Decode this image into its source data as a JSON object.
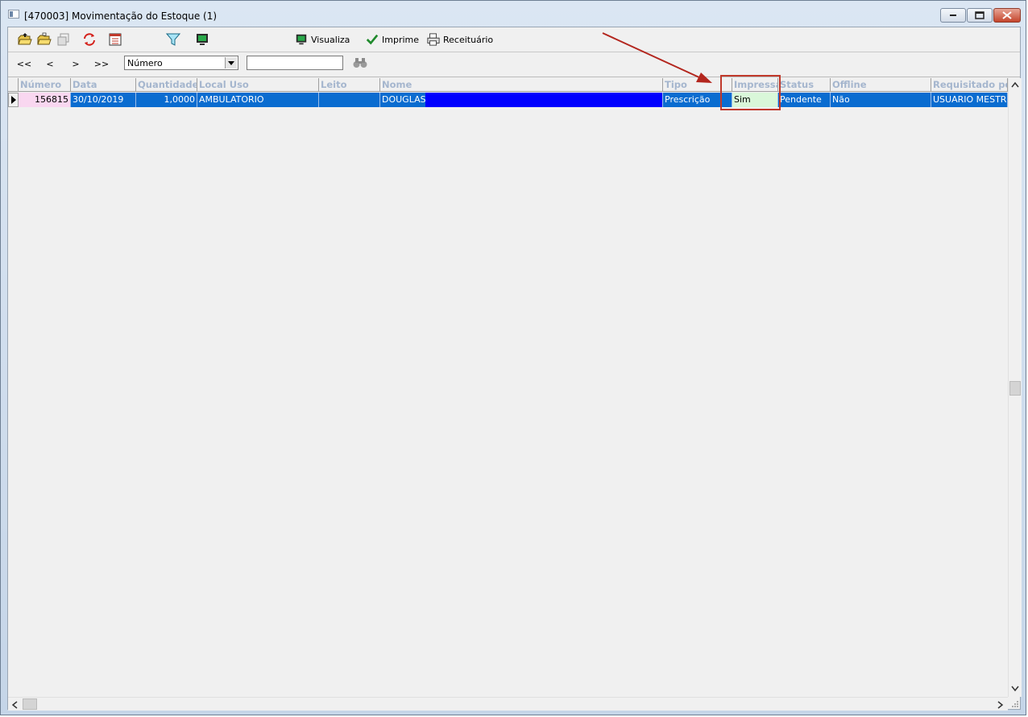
{
  "window": {
    "title": "[470003]  Movimentação do Estoque (1)"
  },
  "toolbar": {
    "visualiza_label": "Visualiza",
    "imprime_label": "Imprime",
    "receituario_label": "Receituário"
  },
  "navbar": {
    "first": "<<",
    "prev": "<",
    "next": ">",
    "last": ">>",
    "sort_field": "Número",
    "search_value": ""
  },
  "grid": {
    "columns": [
      "Número",
      "Data",
      "Quantidade",
      "Local Uso",
      "Leito",
      "Nome",
      "Tipo",
      "Impressa",
      "Status",
      "Offline",
      "Requisitado por"
    ],
    "rows": [
      {
        "numero": "156815",
        "data": "30/10/2019",
        "quantidade": "1,0000",
        "local_uso": "AMBULATORIO",
        "leito": "",
        "nome": "DOUGLAS",
        "tipo": "Prescrição",
        "impressa": "Sim",
        "status": "Pendente",
        "offline": "Não",
        "requisitado_por": "USUARIO MESTRE"
      }
    ]
  },
  "colors": {
    "selection": "#0a6cd0",
    "nome_highlight": "#0000ff",
    "numero_cell": "#f9d7f0",
    "impressa_cell": "#d9f7d9",
    "annotation": "#c0392b"
  }
}
